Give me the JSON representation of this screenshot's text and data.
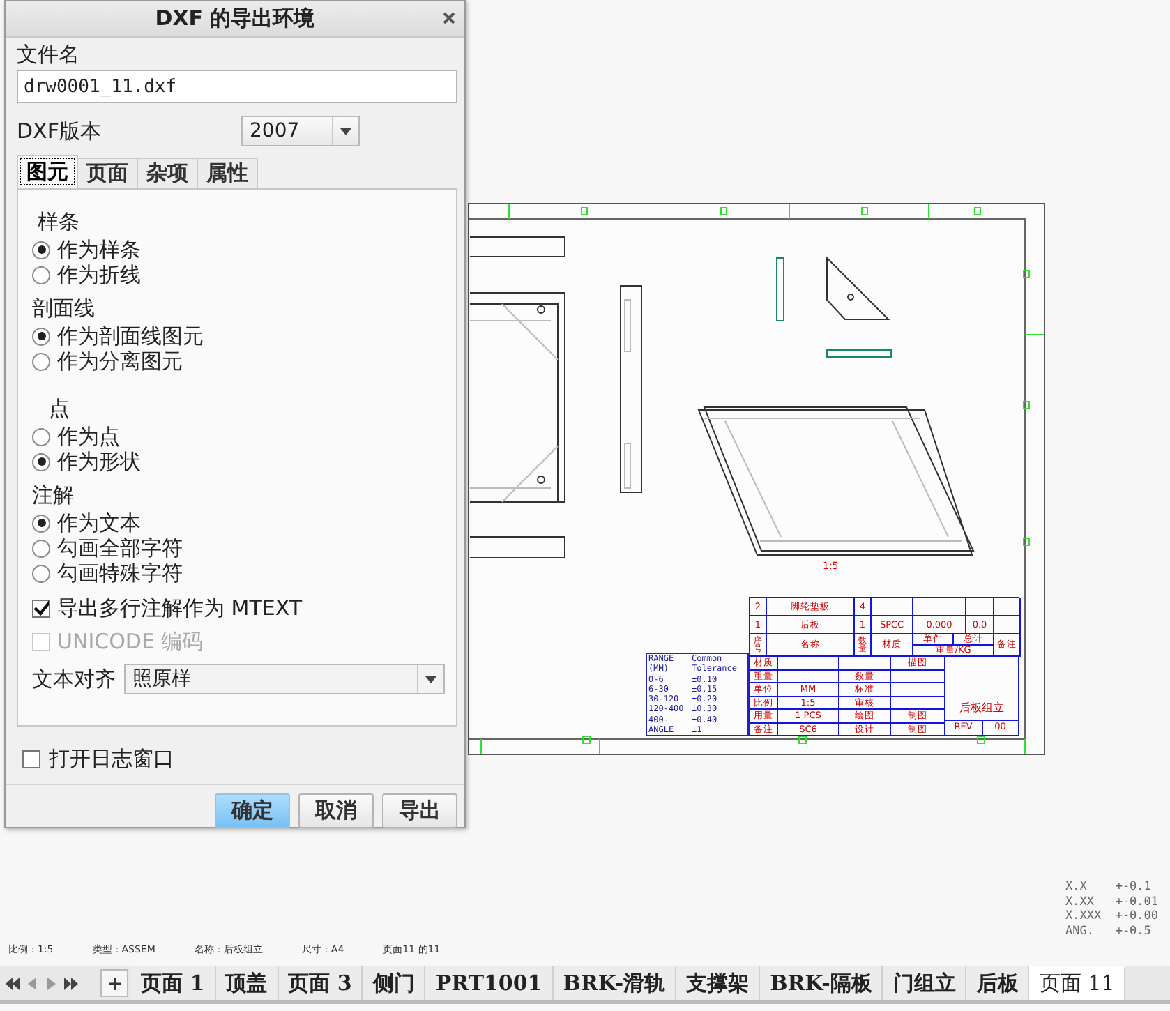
{
  "dialog": {
    "title": "DXF 的导出环境",
    "file_label": "文件名",
    "file_value": "drw0001_11.dxf",
    "version_label": "DXF版本",
    "version_value": "2007",
    "tabs": [
      {
        "label": "图元",
        "selected": true
      },
      {
        "label": "页面",
        "selected": false
      },
      {
        "label": "杂项",
        "selected": false
      },
      {
        "label": "属性",
        "selected": false
      }
    ],
    "groups": [
      {
        "title": "样条",
        "options": [
          {
            "label": "作为样条",
            "selected": true
          },
          {
            "label": "作为折线",
            "selected": false
          }
        ]
      },
      {
        "title": "剖面线",
        "options": [
          {
            "label": "作为剖面线图元",
            "selected": true
          },
          {
            "label": "作为分离图元",
            "selected": false
          }
        ]
      },
      {
        "title": "点",
        "options": [
          {
            "label": "作为点",
            "selected": false
          },
          {
            "label": "作为形状",
            "selected": true
          }
        ]
      },
      {
        "title": "注解",
        "options": [
          {
            "label": "作为文本",
            "selected": true
          },
          {
            "label": "勾画全部字符",
            "selected": false
          },
          {
            "label": "勾画特殊字符",
            "selected": false
          }
        ]
      }
    ],
    "checkboxes": [
      {
        "label": "导出多行注解作为 MTEXT",
        "checked": true,
        "disabled": false
      },
      {
        "label": "UNICODE 编码",
        "checked": false,
        "disabled": true
      }
    ],
    "align_label": "文本对齐",
    "align_value": "照原样",
    "log_checkbox": {
      "label": "打开日志窗口",
      "checked": false
    },
    "buttons": [
      {
        "label": "确定",
        "default": true
      },
      {
        "label": "取消",
        "default": false
      },
      {
        "label": "导出",
        "default": false
      }
    ]
  },
  "drawing": {
    "scale_label": "1:5",
    "tolerance_rows": [
      [
        "RANGE",
        "Common"
      ],
      [
        "(MM)",
        "Tolerance"
      ],
      [
        "0-6",
        "±0.10"
      ],
      [
        "6-30",
        "±0.15"
      ],
      [
        "30-120",
        "±0.20"
      ],
      [
        "120-400",
        "±0.30"
      ],
      [
        "400-",
        "±0.40"
      ],
      [
        "ANGLE",
        "±1"
      ]
    ],
    "parts_rows": [
      [
        "2",
        "脚轮垫板",
        "4",
        "",
        "",
        "",
        ""
      ],
      [
        "1",
        "后板",
        "1",
        "SPCC",
        "0.000",
        "0.0",
        ""
      ]
    ],
    "parts_header": [
      "序号",
      "名称",
      "数量",
      "材质",
      "单件",
      "总计",
      "重量/KG",
      "备注"
    ],
    "info_rows": [
      [
        "材质",
        "",
        "",
        "描图"
      ],
      [
        "重量",
        "",
        "数量",
        ""
      ],
      [
        "单位",
        "MM",
        "标准",
        ""
      ],
      [
        "比例",
        "1:5",
        "审核",
        ""
      ],
      [
        "用量",
        "1 PCS",
        "绘图",
        "制图"
      ],
      [
        "备注",
        "SC6",
        "设计",
        "制图"
      ]
    ],
    "product_name": "后板组立",
    "rev_label": "REV",
    "rev_value": "00"
  },
  "status_bar": [
    "比例：1:5",
    "类型：ASSEM",
    "名称：后板组立",
    "尺寸：A4",
    "页面11 的11"
  ],
  "tolerance_notes": [
    "X.X    +-0.1",
    "X.XX   +-0.01",
    "X.XXX  +-0.00",
    "ANG.   +-0.5"
  ],
  "sheet_tabs": [
    {
      "label": "页面 1",
      "selected": false
    },
    {
      "label": "顶盖",
      "selected": false
    },
    {
      "label": "页面 3",
      "selected": false
    },
    {
      "label": "侧门",
      "selected": false
    },
    {
      "label": "PRT1001",
      "selected": false
    },
    {
      "label": "BRK-滑轨",
      "selected": false
    },
    {
      "label": "支撑架",
      "selected": false
    },
    {
      "label": "BRK-隔板",
      "selected": false
    },
    {
      "label": "门组立",
      "selected": false
    },
    {
      "label": "后板",
      "selected": false
    },
    {
      "label": "页面 11",
      "selected": true
    }
  ]
}
